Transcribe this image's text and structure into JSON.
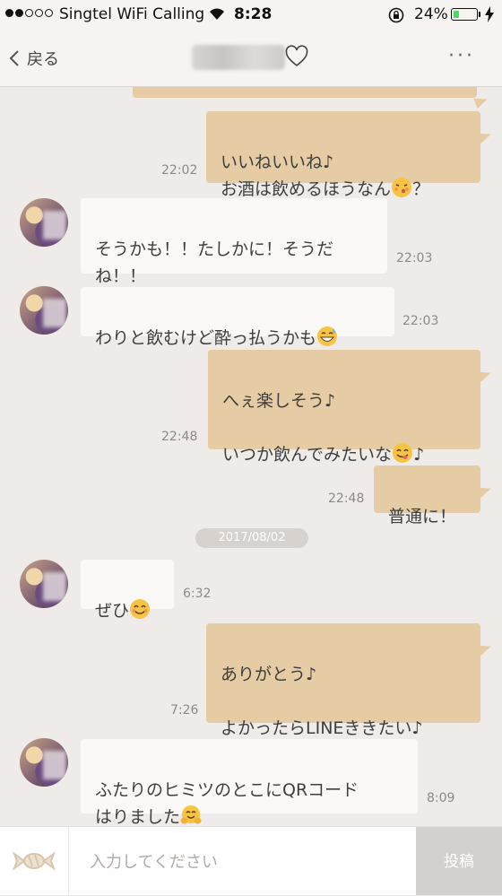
{
  "status": {
    "carrier": "Singtel WiFi Calling",
    "time": "8:28",
    "battery_percent": "24%",
    "battery_level": 0.24,
    "battery_color": "#4cd964"
  },
  "nav": {
    "back_label": "戻る",
    "more_label": "···",
    "heart_icon": "heart-outline-icon"
  },
  "messages": [
    {
      "dir": "out",
      "text": "いいねいいね♪\nお酒は飲めるほうなん",
      "emoji": "kissing-face",
      "tail": "？",
      "time": "22:02"
    },
    {
      "dir": "in",
      "text": "そうかも！！たしかに！そうだね！！",
      "time": "22:03"
    },
    {
      "dir": "in",
      "text": "わりと飲むけど酔っ払うかも",
      "emoji": "sweat-smile",
      "time": "22:03"
    },
    {
      "dir": "out",
      "text": "へぇ楽しそう♪\n\nいつか飲んでみたいな",
      "emoji": "yum-face",
      "tail": "♪",
      "time": "22:48"
    },
    {
      "dir": "out",
      "text": "普通に！",
      "time": "22:48"
    },
    {
      "dir": "in",
      "text": "ぜひ",
      "emoji": "smiling-face",
      "time": "6:32"
    },
    {
      "dir": "out",
      "text": "ありがとう♪\n\nよかったらLINEききたい♪",
      "time": "7:26"
    },
    {
      "dir": "in",
      "text": "ふたりのヒミツのとこにQRコード\nはりました",
      "emoji": "hugging-face",
      "time": "8:09"
    }
  ],
  "date_separator": "2017/08/02",
  "input": {
    "placeholder": "入力してください",
    "value": "",
    "post_label": "投稿"
  },
  "colors": {
    "outgoing_bubble": "#e6cca4",
    "incoming_bubble": "#fbf9f7",
    "background": "#efebe8"
  }
}
